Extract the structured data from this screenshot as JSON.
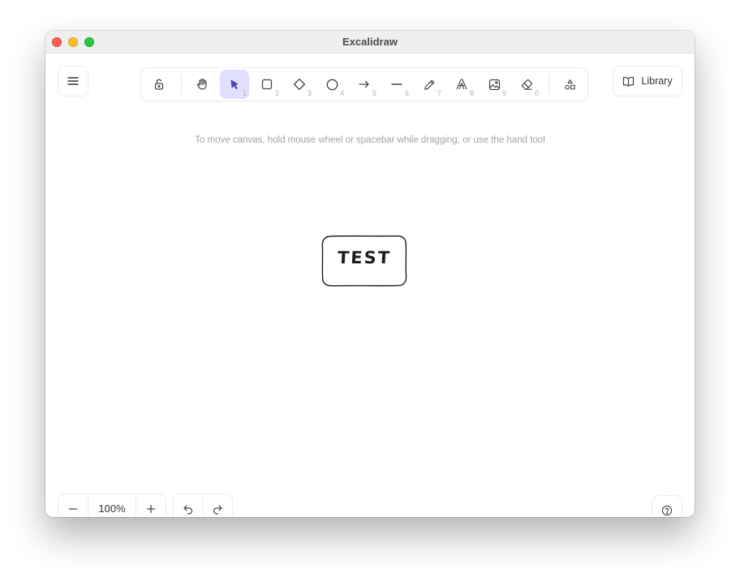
{
  "window": {
    "title": "Excalidraw"
  },
  "toolbar": {
    "tools": [
      {
        "name": "lock",
        "icon": "lock-open-icon",
        "key": ""
      },
      {
        "name": "hand",
        "icon": "hand-icon",
        "key": ""
      },
      {
        "name": "selection",
        "icon": "pointer-icon",
        "key": "1",
        "active": true
      },
      {
        "name": "rectangle",
        "icon": "rectangle-icon",
        "key": "2"
      },
      {
        "name": "diamond",
        "icon": "diamond-icon",
        "key": "3"
      },
      {
        "name": "ellipse",
        "icon": "circle-icon",
        "key": "4"
      },
      {
        "name": "arrow",
        "icon": "arrow-icon",
        "key": "5"
      },
      {
        "name": "line",
        "icon": "line-icon",
        "key": "6"
      },
      {
        "name": "draw",
        "icon": "pencil-icon",
        "key": "7"
      },
      {
        "name": "text",
        "icon": "text-icon",
        "key": "8"
      },
      {
        "name": "image",
        "icon": "image-icon",
        "key": "9"
      },
      {
        "name": "eraser",
        "icon": "eraser-icon",
        "key": "0"
      },
      {
        "name": "extra-tools",
        "icon": "shapes-icon",
        "key": ""
      }
    ],
    "active_color": "#e0dfff",
    "active_icon_color": "#4a47b1"
  },
  "library": {
    "label": "Library"
  },
  "hint": {
    "text": "To move canvas, hold mouse wheel or spacebar while dragging, or use the hand tool"
  },
  "canvas": {
    "elements": [
      {
        "type": "rectangle",
        "text": "TEST",
        "stroke": "#1e1e1e"
      }
    ]
  },
  "footer": {
    "zoom": {
      "value": "100%",
      "decrease_icon": "minus-icon",
      "increase_icon": "plus-icon"
    },
    "undo_icon": "undo-icon",
    "redo_icon": "redo-icon",
    "help_icon": "help-icon"
  }
}
